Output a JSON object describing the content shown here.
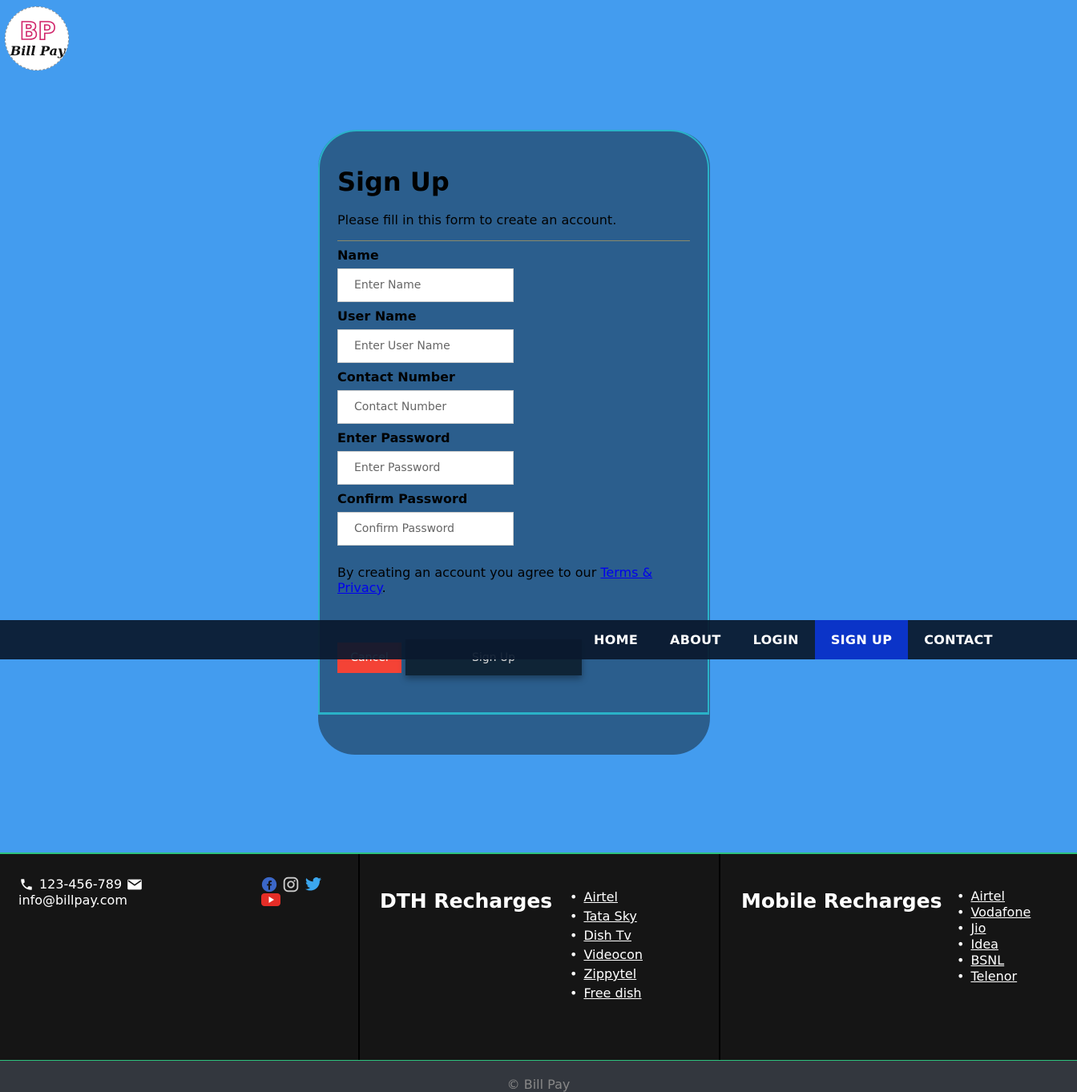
{
  "logo": {
    "initials": "BP",
    "text": "Bill Pay"
  },
  "form": {
    "title": "Sign Up",
    "subtitle": "Please fill in this form to create an account.",
    "fields": [
      {
        "label": "Name",
        "placeholder": "Enter Name"
      },
      {
        "label": "User Name",
        "placeholder": "Enter User Name"
      },
      {
        "label": "Contact Number",
        "placeholder": "Contact Number"
      },
      {
        "label": "Enter Password",
        "placeholder": "Enter Password"
      },
      {
        "label": "Confirm Password",
        "placeholder": "Confirm Password"
      }
    ],
    "terms_prefix": "By creating an account you agree to our ",
    "terms_link": "Terms & Privacy",
    "terms_suffix": ".",
    "cancel_label": "Cancel",
    "signup_label": "Sign Up"
  },
  "nav": {
    "items": [
      "HOME",
      "ABOUT",
      "LOGIN",
      "SIGN UP",
      "CONTACT"
    ],
    "active": "SIGN UP"
  },
  "footer": {
    "phone": "123-456-789",
    "email": "info@billpay.com",
    "social_icons": [
      "facebook-icon",
      "instagram-icon",
      "twitter-icon",
      "youtube-icon"
    ],
    "dth": {
      "title": "DTH Recharges",
      "items": [
        "Airtel",
        "Tata Sky",
        "Dish Tv",
        "Videocon",
        "Zippytel",
        "Free dish"
      ]
    },
    "mobile": {
      "title": "Mobile Recharges",
      "items": [
        "Airtel",
        "Vodafone",
        "Jio",
        "Idea",
        "BSNL",
        "Telenor"
      ]
    },
    "copyright": "© Bill Pay"
  },
  "colors": {
    "page_bg": "#439cef",
    "card_bg": "#2b5e8d",
    "card_border": "#2ab2c8",
    "nav_bg": "#0a192d",
    "nav_active": "#0b34c8",
    "cancel": "#f44336",
    "footer_bg": "#151515",
    "footer_border": "#2ec27e"
  }
}
